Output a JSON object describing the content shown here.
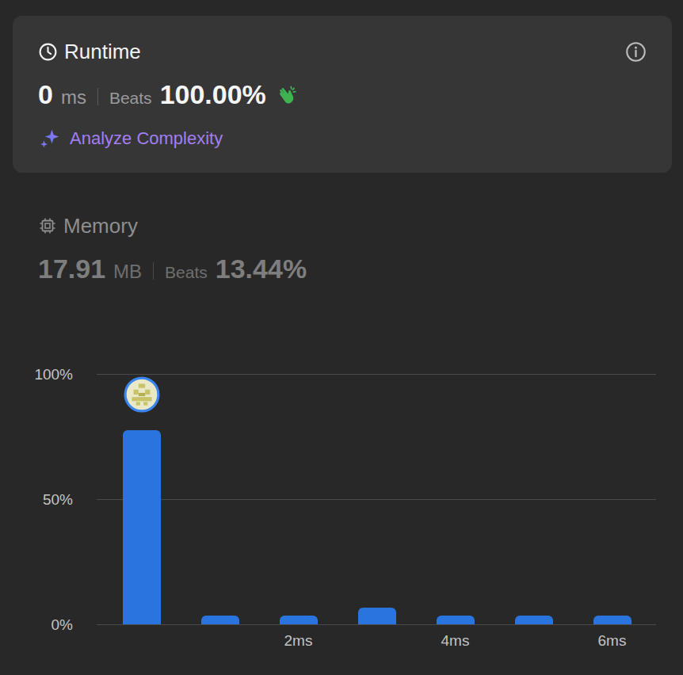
{
  "metrics": [
    {
      "label": "Runtime",
      "value": "0",
      "unit": "ms",
      "beats_label": "Beats",
      "beats": "100.00%",
      "selected": true,
      "action": "Analyze Complexity"
    },
    {
      "label": "Memory",
      "value": "17.91",
      "unit": "MB",
      "beats_label": "Beats",
      "beats": "13.44%",
      "selected": false
    }
  ],
  "chart": {
    "y_ticks": [
      {
        "label": "100%",
        "value": 100
      },
      {
        "label": "50%",
        "value": 50
      },
      {
        "label": "0%",
        "value": 0
      }
    ],
    "bars": [
      {
        "value": 77.4,
        "selected": true
      },
      {
        "value": 3.5,
        "selected": false
      },
      {
        "value": 3.5,
        "selected": false,
        "tick": "2ms"
      },
      {
        "value": 6.7,
        "selected": false
      },
      {
        "value": 3.5,
        "selected": false,
        "tick": "4ms"
      },
      {
        "value": 3.5,
        "selected": false
      },
      {
        "value": 3.5,
        "selected": false,
        "tick": "6ms"
      }
    ]
  }
}
